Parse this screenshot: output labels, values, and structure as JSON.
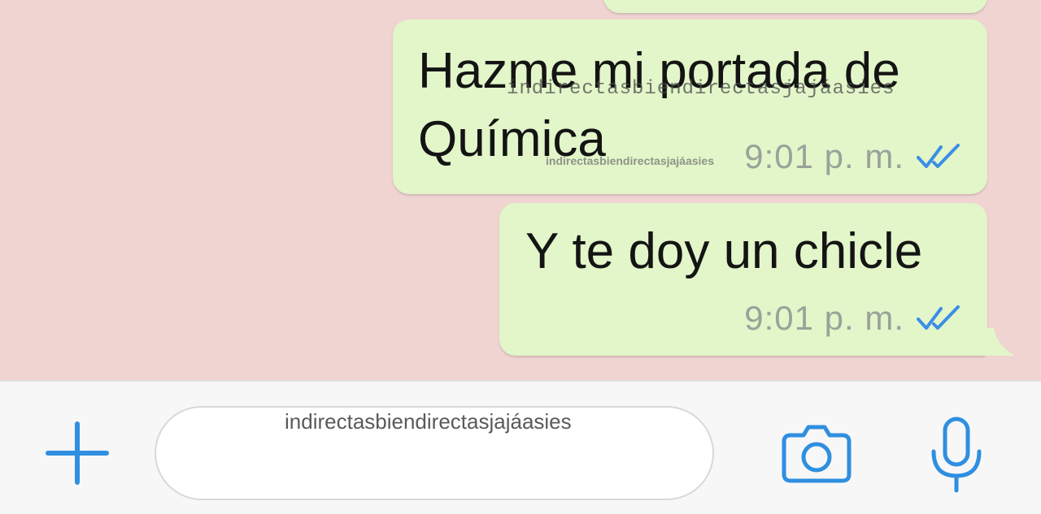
{
  "chat": {
    "messages": [
      {
        "lines": [
          "Hazme mi portada de",
          "Química"
        ],
        "time": "9:01 p. m.",
        "status": "read-double-check"
      },
      {
        "lines": [
          "Y te doy un chicle"
        ],
        "time": "9:01 p. m.",
        "status": "read-double-check"
      }
    ]
  },
  "watermarks": {
    "message_1_line": "indirectasbiendirectasjajáasies",
    "message_1_small": "indirectasbiendirectasjajáasies",
    "input": "indirectasbiendirectasjajáasies"
  },
  "input_bar": {
    "message_value": "",
    "icons": {
      "attach": "plus-icon",
      "camera": "camera-icon",
      "voice": "microphone-icon"
    }
  },
  "colors": {
    "chat_background": "#efd4d2",
    "outgoing_bubble": "#e2f6c9",
    "accent_blue": "#2f8fe0",
    "read_ticks": "#3c8ee6",
    "time_text": "#9aa29a"
  }
}
